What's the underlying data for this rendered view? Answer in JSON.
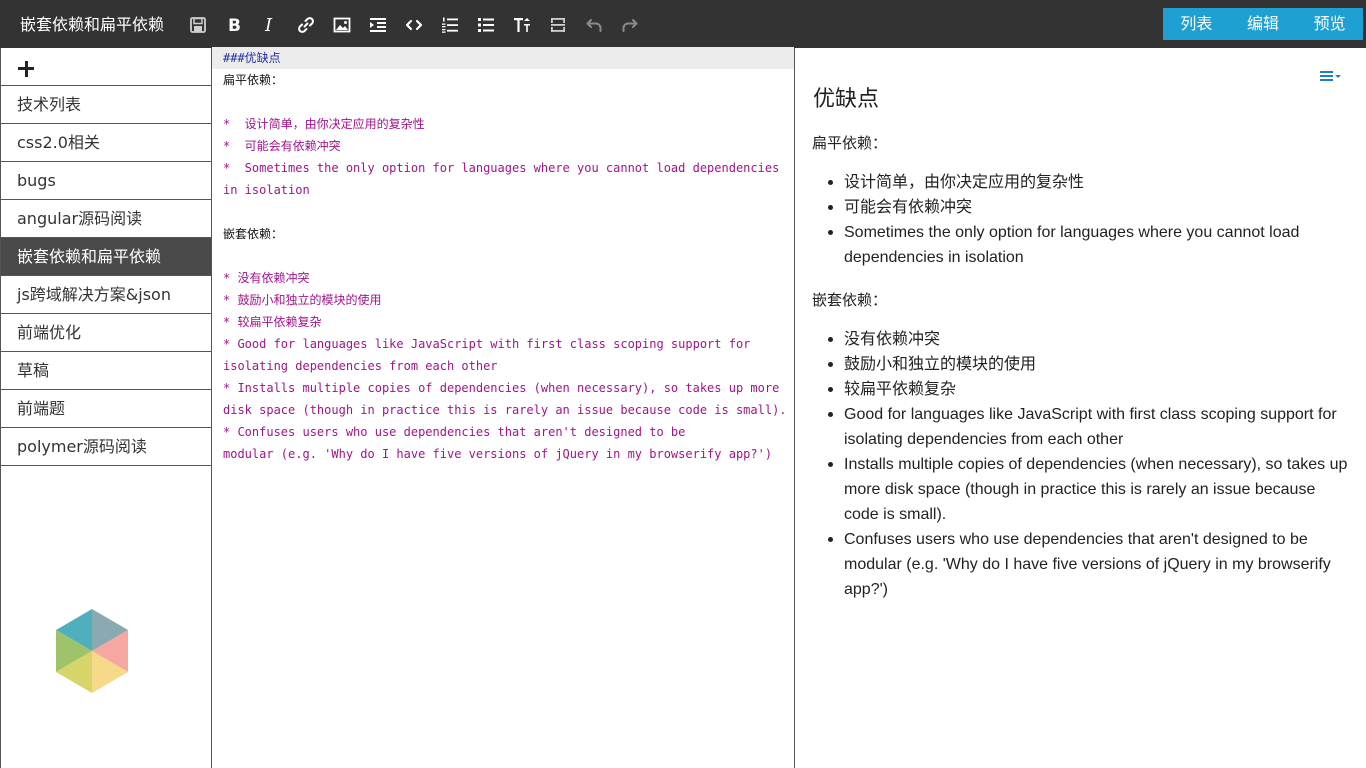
{
  "header": {
    "title": "嵌套依赖和扁平依赖",
    "toolbar": [
      {
        "name": "save-icon"
      },
      {
        "name": "bold-icon"
      },
      {
        "name": "italic-icon"
      },
      {
        "name": "link-icon"
      },
      {
        "name": "image-icon"
      },
      {
        "name": "indent-icon"
      },
      {
        "name": "code-icon"
      },
      {
        "name": "ordered-list-icon"
      },
      {
        "name": "unordered-list-icon"
      },
      {
        "name": "heading-icon"
      },
      {
        "name": "horizontal-rule-icon"
      },
      {
        "name": "undo-icon"
      },
      {
        "name": "redo-icon"
      }
    ],
    "views": {
      "list": "列表",
      "edit": "编辑",
      "preview": "预览"
    },
    "accent_color": "#1fa0d2"
  },
  "sidebar": {
    "add_icon": "plus-icon",
    "items": [
      {
        "label": "技术列表"
      },
      {
        "label": "css2.0相关"
      },
      {
        "label": "bugs"
      },
      {
        "label": "angular源码阅读"
      },
      {
        "label": "嵌套依赖和扁平依赖",
        "active": true
      },
      {
        "label": "js跨域解决方案&json"
      },
      {
        "label": "前端优化"
      },
      {
        "label": "草稿"
      },
      {
        "label": "前端题"
      },
      {
        "label": "polymer源码阅读"
      }
    ]
  },
  "editor": {
    "lines": [
      "###优缺点",
      "扁平依赖：",
      "",
      "*  设计简单，由你决定应用的复杂性",
      "*  可能会有依赖冲突",
      "*  Sometimes the only option for languages where you cannot load dependencies",
      "in isolation",
      "",
      "嵌套依赖：",
      "",
      "* 没有依赖冲突",
      "* 鼓励小和独立的模块的使用",
      "* 较扁平依赖复杂",
      "* Good for languages like JavaScript with first class scoping support for",
      "isolating dependencies from each other",
      "* Installs multiple copies of dependencies (when necessary), so takes up more",
      "disk space (though in practice this is rarely an issue because code is small).",
      "* Confuses users who use dependencies that aren't designed to be",
      "modular (e.g. 'Why do I have five versions of jQuery in my browserify app?')"
    ]
  },
  "preview": {
    "heading": "优缺点",
    "flat_label": "扁平依赖：",
    "flat_items": [
      "设计简单，由你决定应用的复杂性",
      "可能会有依赖冲突",
      "Sometimes the only option for languages where you cannot load dependencies in isolation"
    ],
    "nested_label": "嵌套依赖：",
    "nested_items": [
      "没有依赖冲突",
      "鼓励小和独立的模块的使用",
      "较扁平依赖复杂",
      "Good for languages like JavaScript with first class scoping support for isolating dependencies from each other",
      "Installs multiple copies of dependencies (when necessary), so takes up more disk space (though in practice this is rarely an issue because code is small).",
      "Confuses users who use dependencies that aren't designed to be modular (e.g. 'Why do I have five versions of jQuery in my browserify app?')"
    ],
    "toc_icon": "toc-menu-icon"
  }
}
